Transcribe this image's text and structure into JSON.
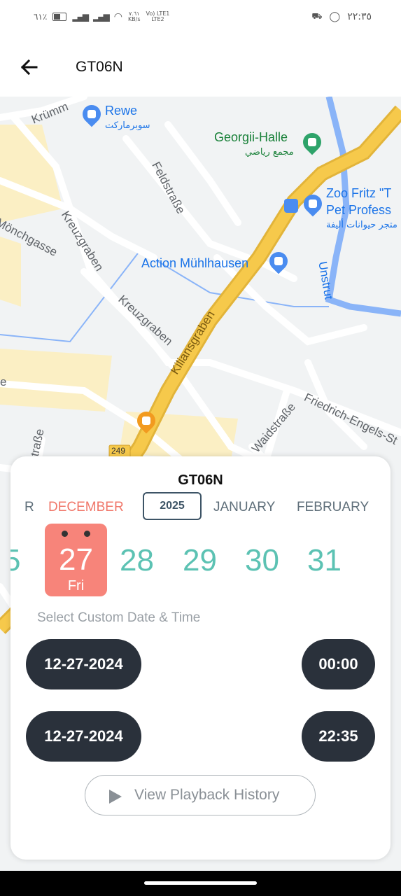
{
  "status_bar": {
    "battery": "٦١٪",
    "speed_value": "٧.٦١",
    "speed_unit": "KB/s",
    "network_top": "Vo) LTE1",
    "network_bottom": "LTE2",
    "time": "٢٢:٣٥"
  },
  "app_bar": {
    "title": "GT06N",
    "back_icon": "arrow-left-icon"
  },
  "map": {
    "labels": {
      "krumm": "Krümm",
      "rewe": "Rewe",
      "rewe_ar": "سوبرماركت",
      "georgii": "Georgii-Halle",
      "georgii_ar": "مجمع رياضي",
      "feldstrasse": "Feldstraße",
      "zoo1": "Zoo Fritz \"T",
      "zoo2": "Pet Profess",
      "zoo_ar": "متجر حيوانات أليفة",
      "monchgasse": "Mönchgasse",
      "kreuzgraben1": "Kreuzgraben",
      "action": "Action Mühlhausen",
      "unstrut": "Unstrut",
      "kreuzgraben2": "Kreuzgraben",
      "kiliansgraben": "Kiliansgraben",
      "friedrich": "Friedrich-Engels-St",
      "waidstrasse": "Waidstraße",
      "route": "249",
      "left_e": "e",
      "left_strasse": "straße"
    }
  },
  "sheet": {
    "title": "GT06N",
    "months": [
      "R",
      "DECEMBER",
      "JANUARY",
      "FEBRUARY"
    ],
    "year": "2025",
    "days": [
      "5",
      "28",
      "29",
      "30",
      "31"
    ],
    "selected_day": {
      "number": "27",
      "weekday": "Fri"
    },
    "custom_label": "Select Custom Date & Time",
    "start": {
      "date": "12-27-2024",
      "time": "00:00"
    },
    "end": {
      "date": "12-27-2024",
      "time": "22:35"
    },
    "playback_label": "View Playback History",
    "playback_icon": "play-icon"
  },
  "colors": {
    "accent": "#f7847a",
    "day_teal": "#5cc2b3",
    "pill_dark": "#2a313b",
    "highway": "#f6c94b"
  }
}
